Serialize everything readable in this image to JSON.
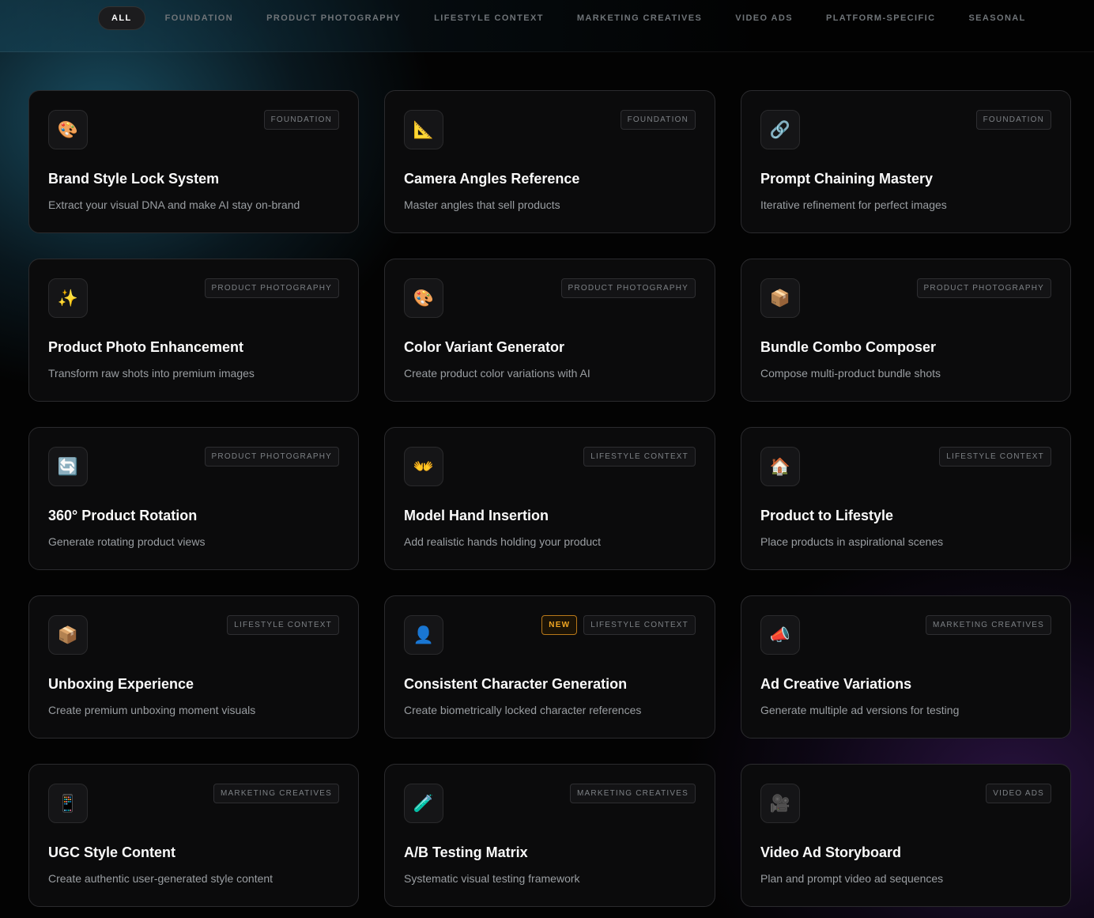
{
  "tabs": [
    {
      "label": "ALL",
      "active": true
    },
    {
      "label": "FOUNDATION"
    },
    {
      "label": "PRODUCT PHOTOGRAPHY"
    },
    {
      "label": "LIFESTYLE CONTEXT"
    },
    {
      "label": "MARKETING CREATIVES"
    },
    {
      "label": "VIDEO ADS"
    },
    {
      "label": "PLATFORM-SPECIFIC"
    },
    {
      "label": "SEASONAL"
    }
  ],
  "cards": [
    {
      "icon": "palette-icon",
      "glyph": "🎨",
      "category": "FOUNDATION",
      "title": "Brand Style Lock System",
      "desc": "Extract your visual DNA and make AI stay on-brand"
    },
    {
      "icon": "triangle-ruler-icon",
      "glyph": "📐",
      "category": "FOUNDATION",
      "title": "Camera Angles Reference",
      "desc": "Master angles that sell products"
    },
    {
      "icon": "link-icon",
      "glyph": "🔗",
      "category": "FOUNDATION",
      "title": "Prompt Chaining Mastery",
      "desc": "Iterative refinement for perfect images"
    },
    {
      "icon": "sparkles-icon",
      "glyph": "✨",
      "category": "PRODUCT PHOTOGRAPHY",
      "title": "Product Photo Enhancement",
      "desc": "Transform raw shots into premium images"
    },
    {
      "icon": "palette-icon",
      "glyph": "🎨",
      "category": "PRODUCT PHOTOGRAPHY",
      "title": "Color Variant Generator",
      "desc": "Create product color variations with AI"
    },
    {
      "icon": "package-icon",
      "glyph": "📦",
      "category": "PRODUCT PHOTOGRAPHY",
      "title": "Bundle Combo Composer",
      "desc": "Compose multi-product bundle shots"
    },
    {
      "icon": "rotate-arrows-icon",
      "glyph": "🔄",
      "category": "PRODUCT PHOTOGRAPHY",
      "title": "360° Product Rotation",
      "desc": "Generate rotating product views"
    },
    {
      "icon": "open-hands-icon",
      "glyph": "👐",
      "category": "LIFESTYLE CONTEXT",
      "title": "Model Hand Insertion",
      "desc": "Add realistic hands holding your product"
    },
    {
      "icon": "house-icon",
      "glyph": "🏠",
      "category": "LIFESTYLE CONTEXT",
      "title": "Product to Lifestyle",
      "desc": "Place products in aspirational scenes"
    },
    {
      "icon": "package-icon",
      "glyph": "📦",
      "category": "LIFESTYLE CONTEXT",
      "title": "Unboxing Experience",
      "desc": "Create premium unboxing moment visuals"
    },
    {
      "icon": "person-silhouette-icon",
      "glyph": "👤",
      "category": "LIFESTYLE CONTEXT",
      "new_label": "NEW",
      "title": "Consistent Character Generation",
      "desc": "Create biometrically locked character references"
    },
    {
      "icon": "megaphone-icon",
      "glyph": "📣",
      "category": "MARKETING CREATIVES",
      "title": "Ad Creative Variations",
      "desc": "Generate multiple ad versions for testing"
    },
    {
      "icon": "mobile-phone-icon",
      "glyph": "📱",
      "category": "MARKETING CREATIVES",
      "title": "UGC Style Content",
      "desc": "Create authentic user-generated style content"
    },
    {
      "icon": "test-tube-icon",
      "glyph": "🧪",
      "category": "MARKETING CREATIVES",
      "title": "A/B Testing Matrix",
      "desc": "Systematic visual testing framework"
    },
    {
      "icon": "video-camera-icon",
      "glyph": "🎥",
      "category": "VIDEO ADS",
      "title": "Video Ad Storyboard",
      "desc": "Plan and prompt video ad sequences"
    }
  ]
}
